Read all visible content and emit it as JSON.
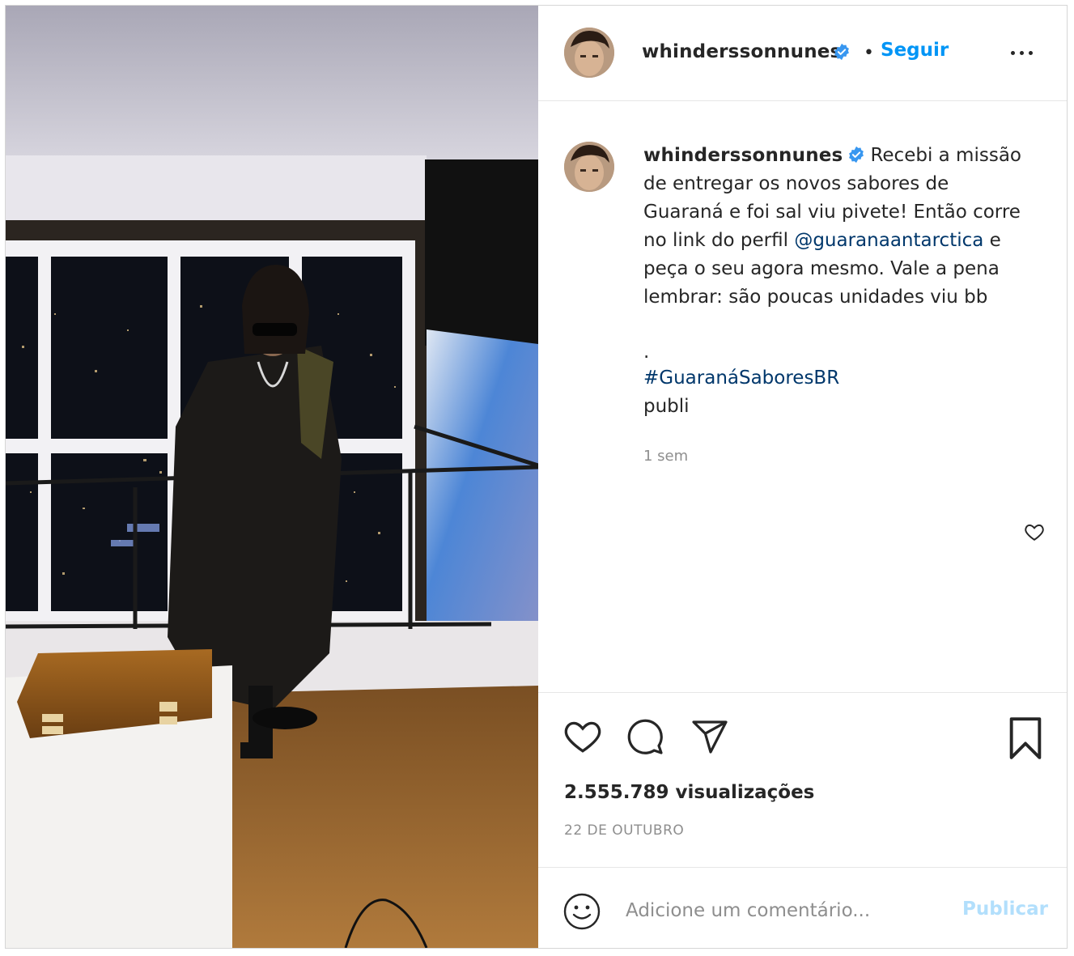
{
  "post": {
    "username": "whinderssonnunes",
    "follow_label": "Seguir",
    "separator": "•",
    "caption_lines": [
      "Recebi a missão",
      "de entregar os novos sabores de",
      "Guaraná e foi sal viu pivete! Então corre",
      "no link do perfil",
      "@guaranaantarctica",
      "e",
      "peça o seu agora mesmo. Vale a pena",
      "lembrar: são poucas unidades viu bb",
      ".",
      "#GuaranáSaboresBR",
      "publi"
    ],
    "time_ago": "1 sem",
    "views": "2.555.789 visualizações",
    "date": "22 DE OUTUBRO",
    "comment_placeholder": "Adicione um comentário...",
    "publish_label": "Publicar"
  },
  "colors": {
    "link": "#00376b",
    "follow": "#0095f6",
    "verified": "#3897f0",
    "publish_disabled": "#b2dffc",
    "muted": "#8e8e8e"
  },
  "icons": [
    "verified-icon",
    "more-options-icon",
    "heart-icon",
    "comment-icon",
    "share-icon",
    "bookmark-icon",
    "emoji-icon"
  ]
}
